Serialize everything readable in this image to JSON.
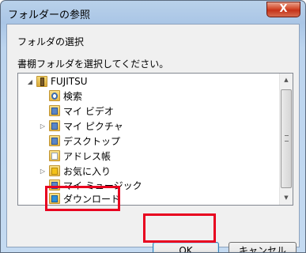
{
  "window": {
    "title": "フォルダーの参照",
    "close_glyph": "X"
  },
  "dialog": {
    "heading": "フォルダの選択",
    "instruction": "書棚フォルダを選択してください。"
  },
  "tree": {
    "root": {
      "label": "FUJITSU",
      "expander": "◢",
      "icon": "user-folder-icon"
    },
    "items": [
      {
        "label": "検索",
        "expander": "",
        "icon": "search-folder-icon"
      },
      {
        "label": "マイ ビデオ",
        "expander": "",
        "icon": "videos-folder-icon"
      },
      {
        "label": "マイ ピクチャ",
        "expander": "▷",
        "icon": "pictures-folder-icon"
      },
      {
        "label": "デスクトップ",
        "expander": "",
        "icon": "desktop-folder-icon"
      },
      {
        "label": "アドレス帳",
        "expander": "",
        "icon": "contacts-folder-icon"
      },
      {
        "label": "お気に入り",
        "expander": "▷",
        "icon": "favorites-folder-icon"
      },
      {
        "label": "マイ ミュージック",
        "expander": "",
        "icon": "music-folder-icon"
      },
      {
        "label": "ダウンロード",
        "expander": "",
        "icon": "downloads-folder-icon"
      }
    ]
  },
  "scrollbar": {
    "up_glyph": "▲",
    "down_glyph": "▼"
  },
  "buttons": {
    "ok": "OK",
    "cancel": "キャンセル"
  },
  "colors": {
    "highlight": "#e8001f",
    "close_button": "#c5331a"
  }
}
